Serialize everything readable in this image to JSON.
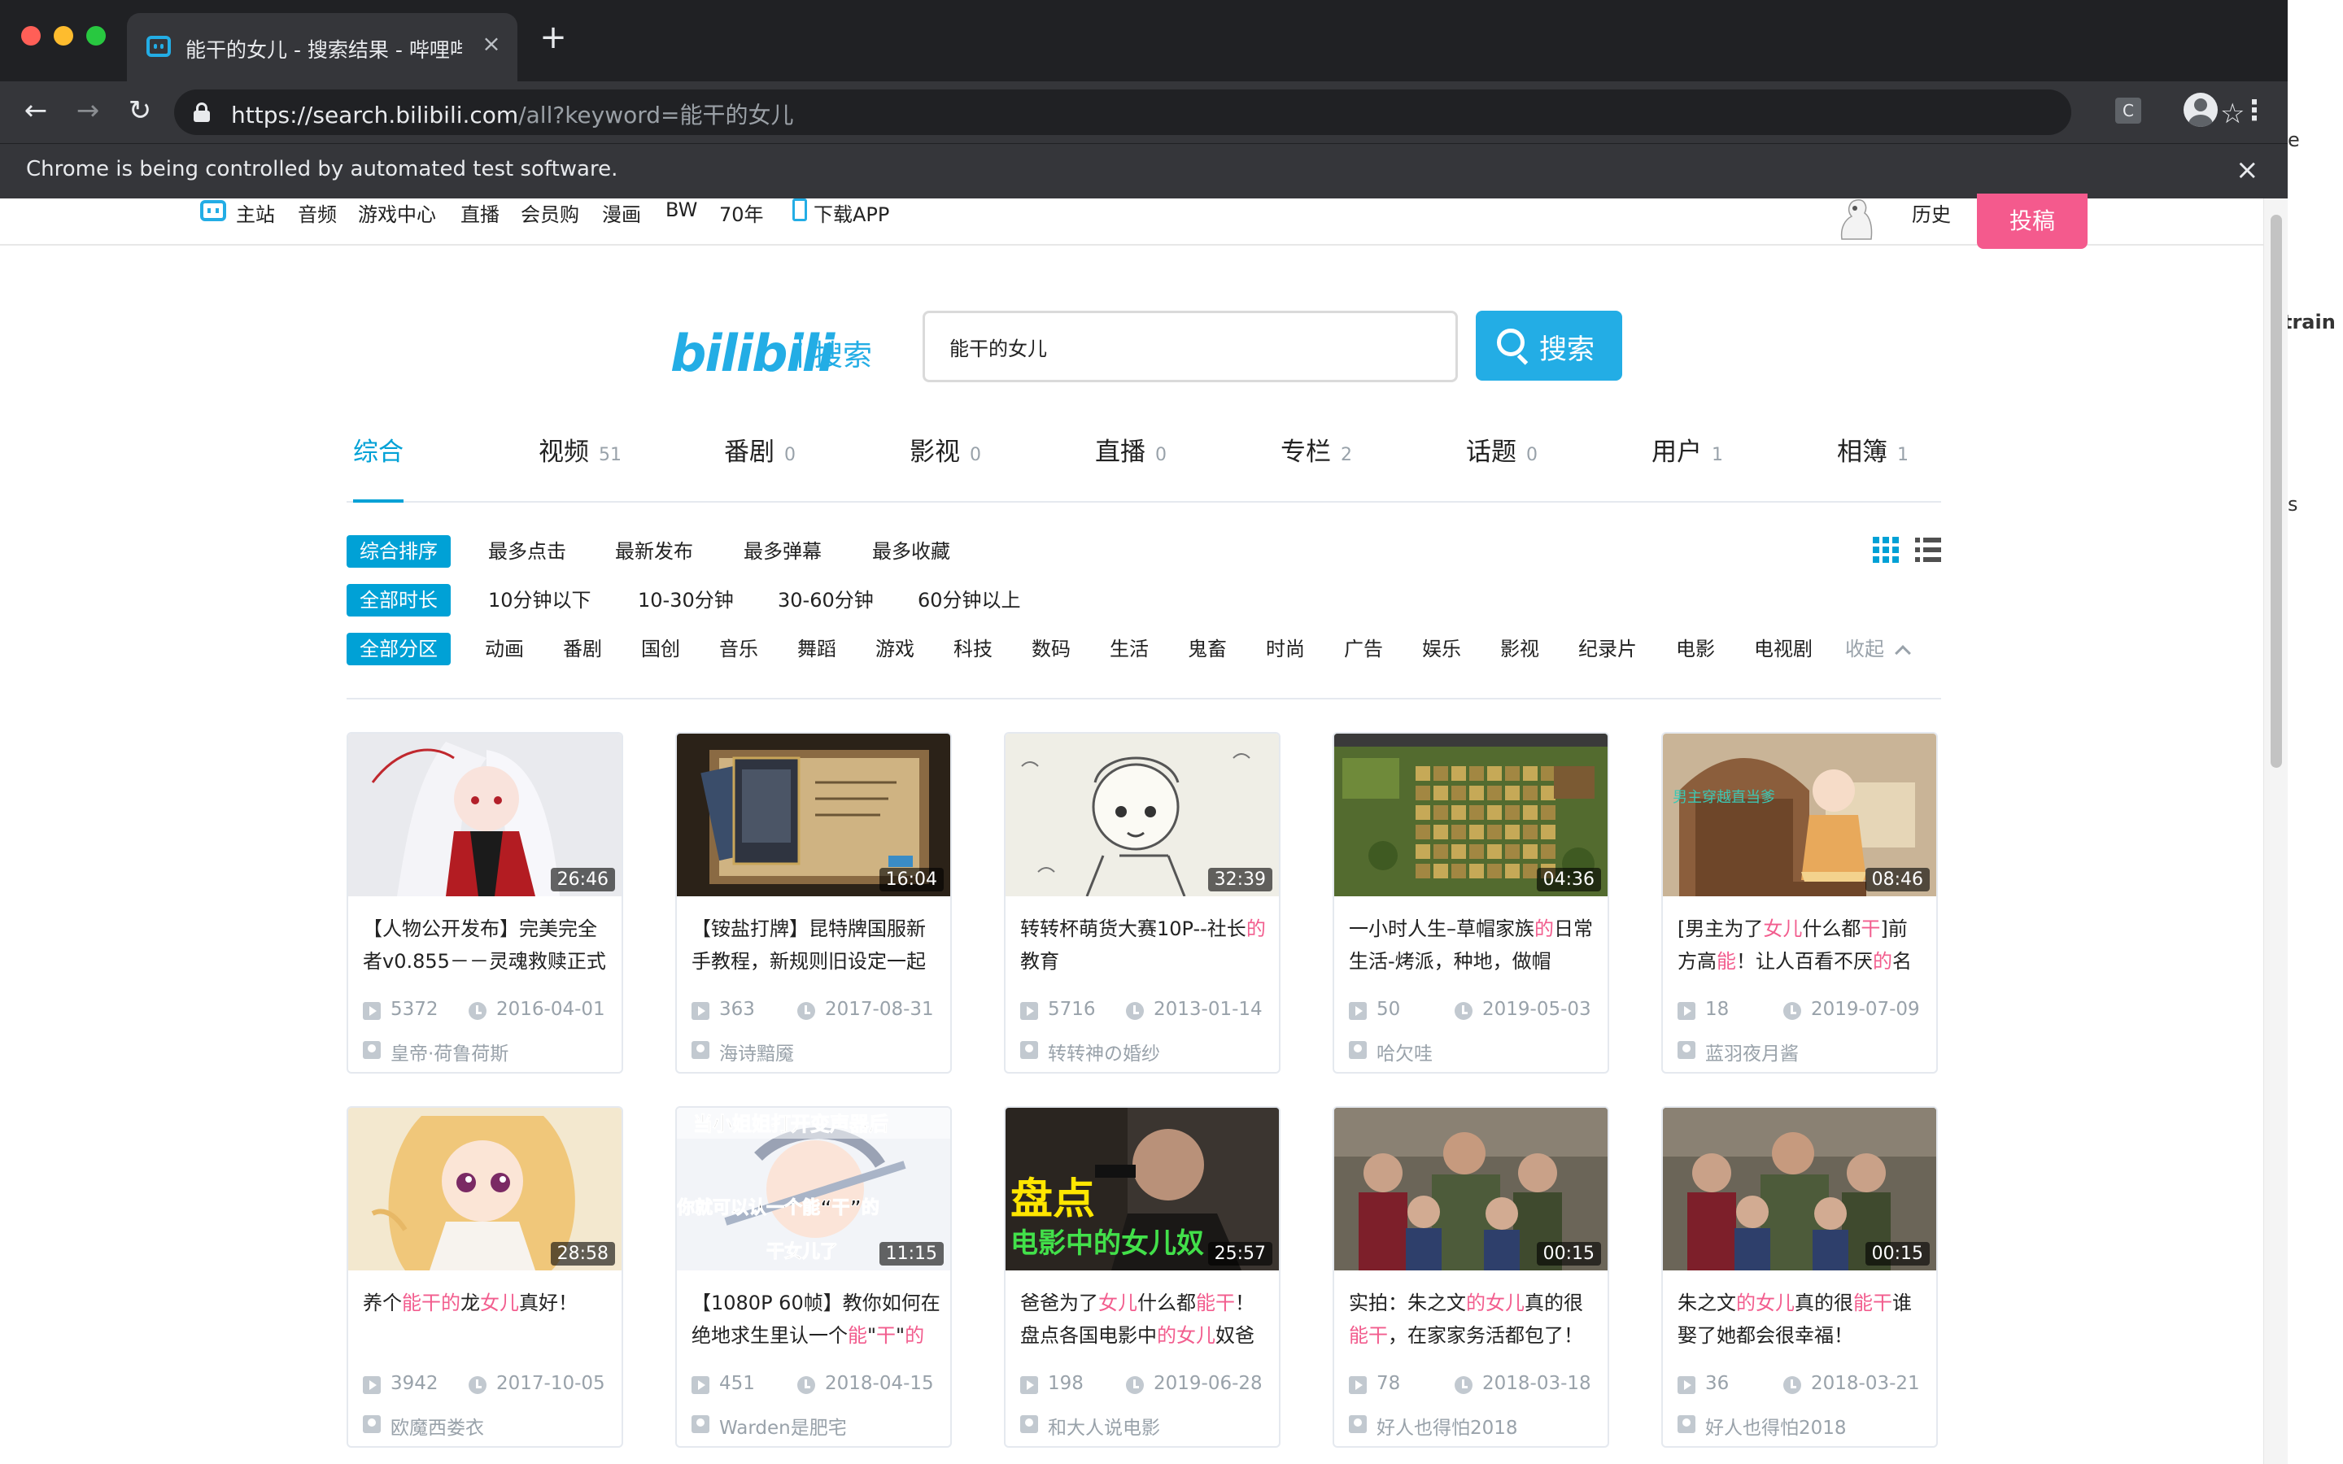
{
  "browser": {
    "tab_title": "能干的女儿 - 搜索结果 - 哔哩哔哩",
    "tab_close": "×",
    "new_tab": "+",
    "url_host": "https://search.bilibili.com",
    "url_path": "/all?keyword=能干的女儿",
    "extension_label": "C",
    "infobar_text": "Chrome is being controlled by automated test software.",
    "infobar_close": "×",
    "side_text": [
      "e",
      "train",
      "s"
    ]
  },
  "topnav": {
    "items": [
      "主站",
      "音频",
      "游戏中心",
      "直播",
      "会员购",
      "漫画",
      "BW",
      "70年",
      "下载APP"
    ],
    "history": "历史",
    "upload": "投稿"
  },
  "search": {
    "logo_text": "bilibili",
    "logo_sub": "搜索",
    "query": "能干的女儿",
    "button_label": "搜索"
  },
  "result_tabs": [
    {
      "label": "综合",
      "count": ""
    },
    {
      "label": "视频",
      "count": "51"
    },
    {
      "label": "番剧",
      "count": "0"
    },
    {
      "label": "影视",
      "count": "0"
    },
    {
      "label": "直播",
      "count": "0"
    },
    {
      "label": "专栏",
      "count": "2"
    },
    {
      "label": "话题",
      "count": "0"
    },
    {
      "label": "用户",
      "count": "1"
    },
    {
      "label": "相簿",
      "count": "1"
    }
  ],
  "filters": {
    "sort": [
      "综合排序",
      "最多点击",
      "最新发布",
      "最多弹幕",
      "最多收藏"
    ],
    "duration": [
      "全部时长",
      "10分钟以下",
      "10-30分钟",
      "30-60分钟",
      "60分钟以上"
    ],
    "zone": [
      "全部分区",
      "动画",
      "番剧",
      "国创",
      "音乐",
      "舞蹈",
      "游戏",
      "科技",
      "数码",
      "生活",
      "鬼畜",
      "时尚",
      "广告",
      "娱乐",
      "影视",
      "纪录片",
      "电影",
      "电视剧"
    ],
    "collapse": "收起"
  },
  "videos": [
    {
      "duration": "26:46",
      "title": [
        [
          "【人物公开发布】完美完全者v0.855－－灵魂救赎正式",
          false
        ]
      ],
      "plays": "5372",
      "date": "2016-04-01",
      "uploader": "皇帝·荷鲁荷斯",
      "thumb": "anime-white-hair"
    },
    {
      "duration": "16:04",
      "title": [
        [
          "【铵盐打牌】昆特牌国服新手教程，新规则旧设定一起",
          false
        ]
      ],
      "plays": "363",
      "date": "2017-08-31",
      "uploader": "海诗黯魇",
      "thumb": "card-game"
    },
    {
      "duration": "32:39",
      "title": [
        [
          "转转杯萌货大赛10P--社长",
          false
        ],
        [
          "的",
          true
        ],
        [
          "教育",
          false
        ]
      ],
      "plays": "5716",
      "date": "2013-01-14",
      "uploader": "转转神の婚纱",
      "thumb": "sketch"
    },
    {
      "duration": "04:36",
      "title": [
        [
          "一小时人生–草帽家族",
          false
        ],
        [
          "的",
          true
        ],
        [
          "日常生活-烤派，种地，做帽",
          false
        ]
      ],
      "plays": "50",
      "date": "2019-05-03",
      "uploader": "哈欠哇",
      "thumb": "pixel-farm"
    },
    {
      "duration": "08:46",
      "title": [
        [
          "[男主为了",
          false
        ],
        [
          "女儿",
          true
        ],
        [
          "什么都",
          false
        ],
        [
          "干",
          true
        ],
        [
          "]前方高",
          false
        ],
        [
          "能",
          true
        ],
        [
          "！让人百看不厌",
          false
        ],
        [
          "的",
          true
        ],
        [
          "名",
          false
        ]
      ],
      "plays": "18",
      "date": "2019-07-09",
      "uploader": "蓝羽夜月酱",
      "thumb": "anime-door"
    },
    {
      "duration": "28:58",
      "title": [
        [
          "养个",
          false
        ],
        [
          "能干的",
          true
        ],
        [
          "龙",
          false
        ],
        [
          "女儿",
          true
        ],
        [
          "真好！",
          false
        ]
      ],
      "plays": "3942",
      "date": "2017-10-05",
      "uploader": "欧魔西娄衣",
      "thumb": "anime-blonde"
    },
    {
      "duration": "11:15",
      "title": [
        [
          "【1080P 60帧】教你如何在绝地求生里认一个",
          false
        ],
        [
          "能",
          true
        ],
        [
          "\"",
          false
        ],
        [
          "干",
          true
        ],
        [
          "\"",
          false
        ],
        [
          "的",
          true
        ]
      ],
      "plays": "451",
      "date": "2018-04-15",
      "uploader": "Warden是肥宅",
      "thumb": "caption-anime"
    },
    {
      "duration": "25:57",
      "title": [
        [
          "爸爸为了",
          false
        ],
        [
          "女儿",
          true
        ],
        [
          "什么都",
          false
        ],
        [
          "能干",
          true
        ],
        [
          "！盘点各国电影中",
          false
        ],
        [
          "的女儿",
          true
        ],
        [
          "奴爸",
          false
        ]
      ],
      "plays": "198",
      "date": "2019-06-28",
      "uploader": "和大人说电影",
      "thumb": "movie-gun"
    },
    {
      "duration": "00:15",
      "title": [
        [
          "实拍：朱之文",
          false
        ],
        [
          "的女儿",
          true
        ],
        [
          "真的很",
          false
        ],
        [
          "能干",
          true
        ],
        [
          "，在家家务活都包了！",
          false
        ]
      ],
      "plays": "78",
      "date": "2018-03-18",
      "uploader": "好人也得怕2018",
      "thumb": "family"
    },
    {
      "duration": "00:15",
      "title": [
        [
          "朱之文",
          false
        ],
        [
          "的女儿",
          true
        ],
        [
          "真的很",
          false
        ],
        [
          "能干",
          true
        ],
        [
          "谁娶了她都会很幸福！",
          false
        ]
      ],
      "plays": "36",
      "date": "2018-03-21",
      "uploader": "好人也得怕2018",
      "thumb": "family"
    }
  ],
  "thumb_captions": {
    "caption_top": "当小姐姐打开变声器后",
    "caption_mid": "你就可以认一个能“干”的",
    "caption_bot": "干女儿了",
    "movie_big": "盘点",
    "movie_sub": "电影中的女儿奴",
    "door_caption": "男主穿越直当爹"
  },
  "colors": {
    "accent": "#00a1d6",
    "highlight": "#f25d8e",
    "upload": "#f45a8d"
  }
}
